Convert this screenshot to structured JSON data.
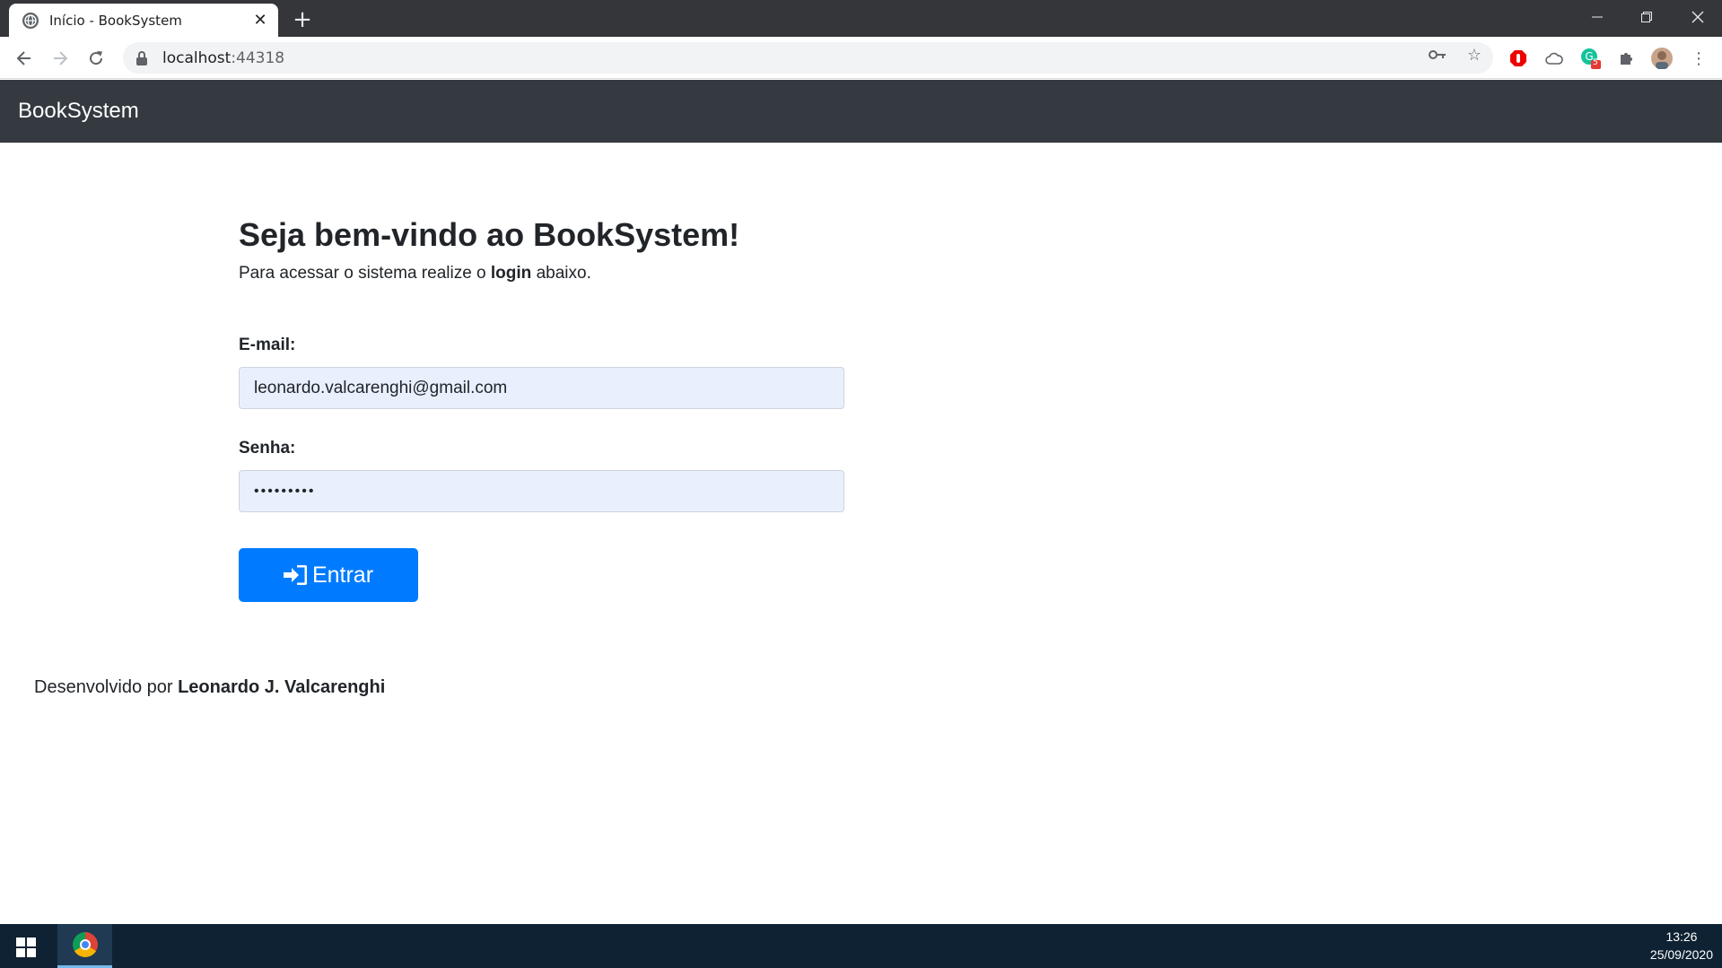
{
  "browser": {
    "tab_title": "Início - BookSystem",
    "url_host": "localhost",
    "url_port": ":44318",
    "extension_badge": "5"
  },
  "page": {
    "brand": "BookSystem",
    "heading": "Seja bem-vindo ao BookSystem!",
    "lead_prefix": "Para acessar o sistema realize o ",
    "lead_bold": "login",
    "lead_suffix": " abaixo.",
    "email_label": "E-mail:",
    "email_value": "leonardo.valcarenghi@gmail.com",
    "password_label": "Senha:",
    "password_value": "•••••••••",
    "submit_label": "Entrar",
    "footer_prefix": "Desenvolvido por ",
    "footer_author": "Leonardo J. Valcarenghi"
  },
  "taskbar": {
    "time": "13:26",
    "date": "25/09/2020"
  },
  "colors": {
    "navbar": "#343a40",
    "primary_button": "#007bff",
    "autofill_input": "#e8f0fe"
  }
}
